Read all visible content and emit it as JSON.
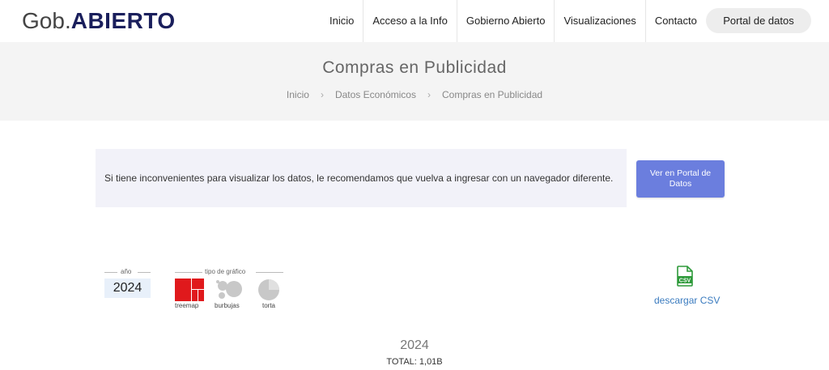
{
  "header": {
    "logo_gob": "Gob",
    "logo_dot": ".",
    "logo_abierto": "ABIERTO",
    "nav": [
      "Inicio",
      "Acceso a la Info",
      "Gobierno Abierto",
      "Visualizaciones",
      "Contacto"
    ],
    "portal_button": "Portal de datos"
  },
  "title_band": {
    "title": "Compras en Publicidad",
    "breadcrumb": [
      "Inicio",
      "Datos Económicos",
      "Compras en Publicidad"
    ],
    "breadcrumb_separator": "›"
  },
  "notice": {
    "text": "Si tiene inconvenientes para visualizar los datos, le recomendamos que vuelva a ingresar con un navegador diferente.",
    "button_line1": "Ver en Portal de",
    "button_line2": "Datos"
  },
  "controls": {
    "year_label": "año",
    "year_value": "2024",
    "chart_type_label": "tipo de gráfico",
    "chart_types": [
      {
        "label": "treemap",
        "icon": "treemap-icon",
        "color": "#e0191c"
      },
      {
        "label": "burbujas",
        "icon": "bubbles-icon",
        "color": "#c8c8c8"
      },
      {
        "label": "torta",
        "icon": "pie-icon",
        "color": "#c8c8c8"
      }
    ],
    "csv_icon_text": "CSV",
    "csv_link": "descargar CSV"
  },
  "summary": {
    "year": "2024",
    "total": "TOTAL: 1,01B"
  },
  "colors": {
    "brand_dark": "#1a1f5c",
    "accent_button": "#6b7ede",
    "active_chart": "#e0191c",
    "csv_green": "#2e9a3a",
    "link": "#3a7bbf"
  }
}
